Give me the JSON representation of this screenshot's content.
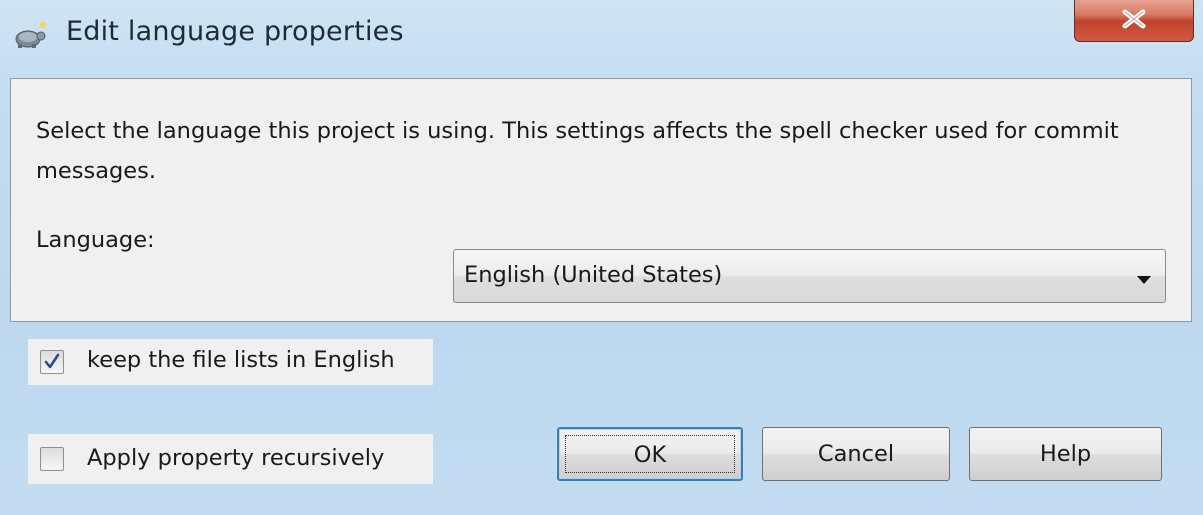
{
  "window": {
    "title": "Edit language properties",
    "app_icon": "tortoise-icon",
    "close_icon": "close-icon"
  },
  "panel": {
    "description": "Select the language this project is using. This settings affects the spell checker used for commit messages.",
    "language_label": "Language:",
    "language_value": "English (United States)",
    "dropdown_icon": "chevron-down-icon"
  },
  "options": {
    "keep_english": {
      "label": "keep the file lists in English",
      "checked": true
    },
    "apply_recursive": {
      "label": "Apply property recursively",
      "checked": false
    }
  },
  "buttons": {
    "ok": "OK",
    "cancel": "Cancel",
    "help": "Help"
  },
  "colors": {
    "window_frame": "#c4ddf2",
    "close_button": "#c0422d",
    "default_button_border": "#3c7fb1",
    "check_mark": "#2a4f8a"
  }
}
